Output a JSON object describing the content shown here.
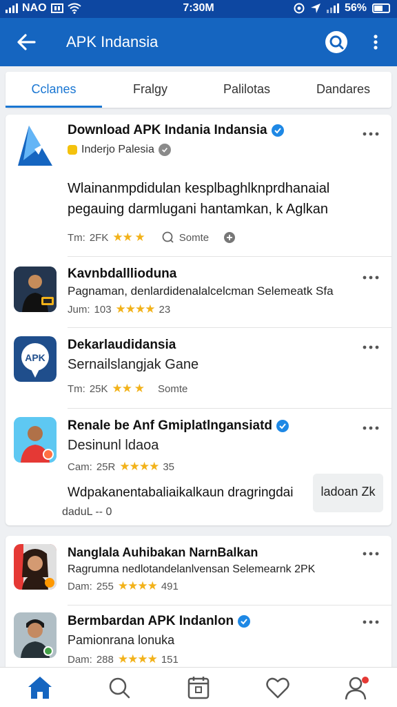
{
  "status": {
    "carrier": "NAO",
    "time": "7:30M",
    "battery": "56%"
  },
  "appbar": {
    "title": "APK Indansia"
  },
  "tabs": [
    {
      "label": "Cclanes",
      "active": true
    },
    {
      "label": "Fralgy",
      "active": false
    },
    {
      "label": "Palilotas",
      "active": false
    },
    {
      "label": "Dandares",
      "active": false
    }
  ],
  "feed": {
    "items": [
      {
        "name": "Download APK Indania Indansia",
        "author": "Inderjo Palesia",
        "desc_line1": "Wlainanmpdidulan kesplbaghlknprdhanaial",
        "desc_line2": "pegauing darmlugani hantamkan, k Aglkan",
        "meta_prefix": "Tm:",
        "meta_count": "2FK",
        "stars": "★★ ★",
        "meta_extra": "Somte"
      },
      {
        "name": "Kavnbdalllioduna",
        "sub": "Pagnaman, denlardidenalalcelcman Selemeatk Sfa",
        "meta_prefix": "Jum:",
        "meta_count": "103",
        "stars": "★★★★",
        "meta_extra": "23"
      },
      {
        "name": "Dekarlaudidansia",
        "sub": "Sernailslangjak Gane",
        "meta_prefix": "Tm:",
        "meta_count": "25K",
        "stars": "★★ ★",
        "meta_extra": "Somte"
      },
      {
        "name": "Renale be Anf Gmiplatlngansiatd",
        "sub": "Desinunl ldaoa",
        "meta_prefix": "Cam:",
        "meta_count": "25R",
        "stars": "★★★★",
        "meta_extra": "35",
        "desc_line1": "Wdpakanentabaliaikalkaun dragringdai",
        "desc_line2": "daduL -- 0",
        "chip_label": "ladoan Zk"
      },
      {
        "name": "Nanglala Auhibakan NarnBalkan",
        "sub": "Ragrumna nedlotandelanlvensan Selemearnk 2PK",
        "meta_prefix": "Dam:",
        "meta_count": "255",
        "stars": "★★★★",
        "meta_extra": "491"
      },
      {
        "name": "Bermbardan APK Indanlon",
        "sub": "Pamionrana lonuka",
        "meta_prefix": "Dam:",
        "meta_count": "288",
        "stars": "★★★★",
        "meta_extra": "151"
      }
    ]
  },
  "colors": {
    "statusbar": "#0d47a1",
    "appbar": "#1565c0",
    "accent": "#1976d2",
    "star": "#f2b21a"
  }
}
